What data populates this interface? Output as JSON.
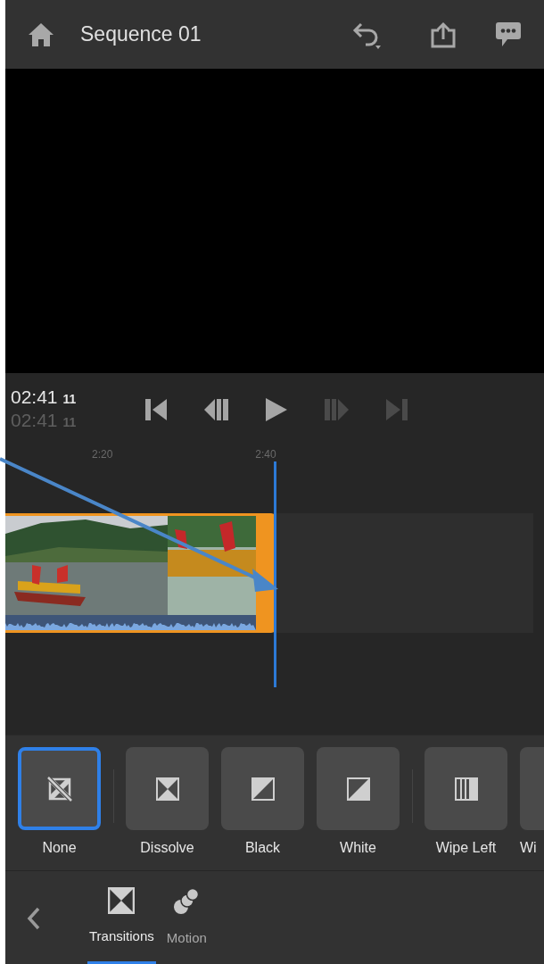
{
  "header": {
    "title": "Sequence 01"
  },
  "timecode": {
    "current": "02:41",
    "current_frames": "11",
    "total": "02:41",
    "total_frames": "11"
  },
  "playback": [
    {
      "kind": "start",
      "disabled": false
    },
    {
      "kind": "back",
      "disabled": false
    },
    {
      "kind": "play",
      "disabled": false
    },
    {
      "kind": "forward",
      "disabled": true
    },
    {
      "kind": "end",
      "disabled": true
    }
  ],
  "ruler": [
    "2:20",
    "2:40"
  ],
  "transitions": [
    {
      "label": "None",
      "kind": "none",
      "selected": true,
      "separator_before": false
    },
    {
      "label": "Dissolve",
      "kind": "dissolve",
      "selected": false,
      "separator_before": true
    },
    {
      "label": "Black",
      "kind": "black",
      "selected": false,
      "separator_before": false
    },
    {
      "label": "White",
      "kind": "white",
      "selected": false,
      "separator_before": false
    },
    {
      "label": "Wipe Left",
      "kind": "wipe",
      "selected": false,
      "separator_before": true
    },
    {
      "label": "Wi",
      "kind": "blank",
      "selected": false,
      "separator_before": false
    }
  ],
  "tabs": [
    {
      "label": "Transitions",
      "kind": "transitions",
      "selected": true
    },
    {
      "label": "Motion",
      "kind": "motion",
      "selected": false
    }
  ]
}
